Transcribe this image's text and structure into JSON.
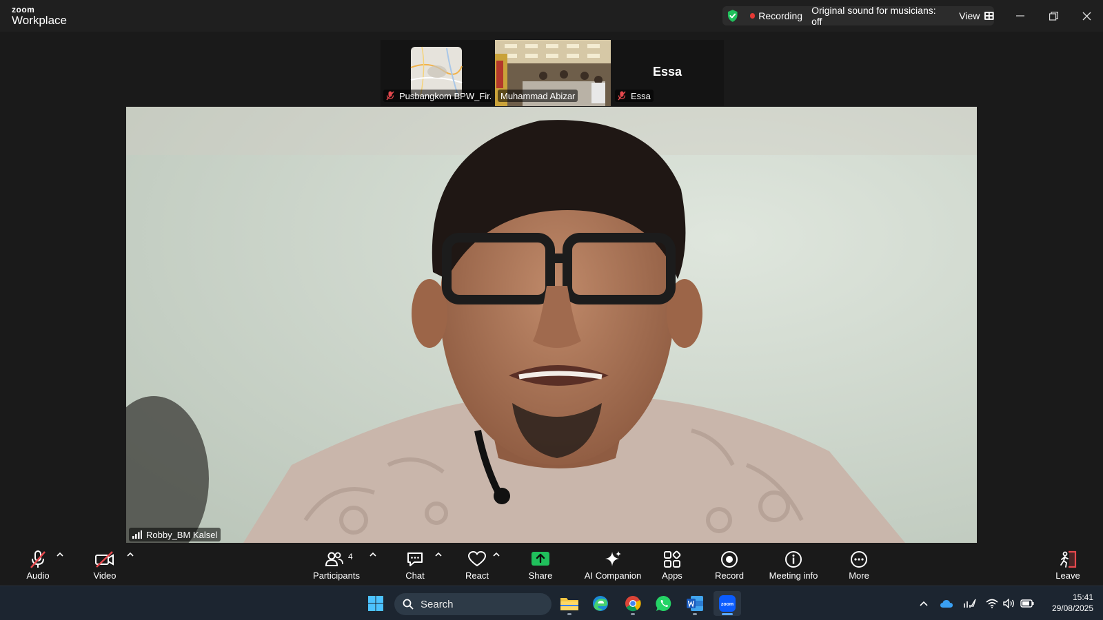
{
  "titlebar": {
    "brand_small": "zoom",
    "brand_large": "Workplace",
    "recording_label": "Recording",
    "original_sound_label": "Original sound for musicians: off",
    "view_label": "View"
  },
  "thumbnails": [
    {
      "name": "Pusbangkom BPW_Fir...",
      "muted": true,
      "kind": "map-image"
    },
    {
      "name": "Muhammad Abizar",
      "muted": false,
      "kind": "room-video"
    },
    {
      "name": "Essa",
      "muted": true,
      "kind": "name-only"
    }
  ],
  "main_video": {
    "name": "Robby_BM Kalsel"
  },
  "toolbar": {
    "audio": "Audio",
    "video": "Video",
    "participants": "Participants",
    "participants_count": "4",
    "chat": "Chat",
    "react": "React",
    "share": "Share",
    "ai_companion": "AI Companion",
    "apps": "Apps",
    "record": "Record",
    "meeting_info": "Meeting info",
    "more": "More",
    "leave": "Leave"
  },
  "taskbar": {
    "search_label": "Search",
    "time": "15:41",
    "date": "29/08/2025"
  },
  "colors": {
    "accent_green": "#20c05c",
    "recording_red": "#e53935",
    "leave_red": "#e5484d",
    "taskbar_bg": "#1c2530"
  }
}
